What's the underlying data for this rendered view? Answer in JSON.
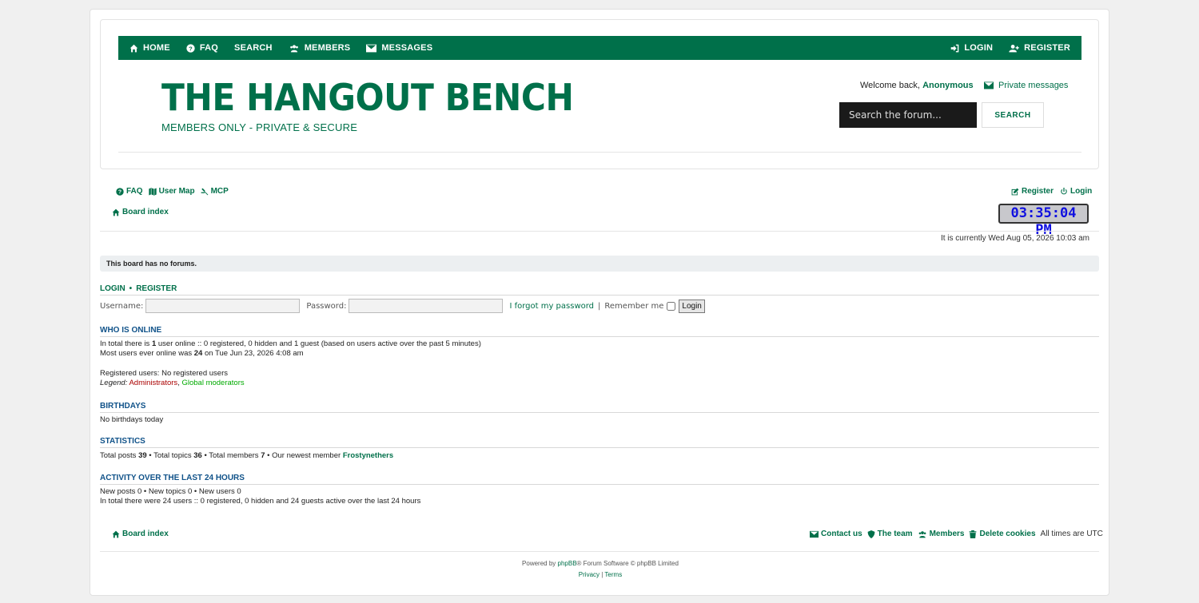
{
  "nav": {
    "left": [
      {
        "label": "HOME",
        "icon": "home-icon"
      },
      {
        "label": "FAQ",
        "icon": "question-icon"
      },
      {
        "label": "SEARCH",
        "icon": ""
      },
      {
        "label": "MEMBERS",
        "icon": "users-icon"
      },
      {
        "label": "MESSAGES",
        "icon": "envelope-icon"
      }
    ],
    "right": [
      {
        "label": "LOGIN",
        "icon": "sign-in-icon"
      },
      {
        "label": "REGISTER",
        "icon": "user-plus-icon"
      }
    ]
  },
  "site": {
    "title": "THE HANGOUT BENCH",
    "subtitle": "MEMBERS ONLY - PRIVATE & SECURE"
  },
  "welcome": {
    "prefix": "Welcome back,",
    "user": "Anonymous",
    "pm_label": "Private messages"
  },
  "search": {
    "placeholder": "Search the forum...",
    "button": "SEARCH"
  },
  "quicklinks": {
    "faq": "FAQ",
    "usermap": "User Map",
    "mcp": "MCP",
    "register": "Register",
    "login": "Login"
  },
  "breadcrumb": "Board index",
  "clock": "03:35:04 PM",
  "current_time": "It is currently Wed Aug 05, 2026 10:03 am",
  "notice": "This board has no forums.",
  "login": {
    "title_login": "LOGIN",
    "sep": "•",
    "title_register": "REGISTER",
    "username_label": "Username:",
    "password_label": "Password:",
    "forgot": "I forgot my password",
    "remember": "Remember me",
    "button": "Login"
  },
  "online": {
    "title": "WHO IS ONLINE",
    "line1_a": "In total there is ",
    "line1_b": "1",
    "line1_c": " user online :: 0 registered, 0 hidden and 1 guest (based on users active over the past 5 minutes)",
    "line2_a": "Most users ever online was ",
    "line2_b": "24",
    "line2_c": " on Tue Jun 23, 2026 4:08 am",
    "registered": "Registered users: No registered users",
    "legend_label": "Legend:",
    "legend_admins": "Administrators",
    "legend_comma": ", ",
    "legend_gmods": "Global moderators"
  },
  "birthdays": {
    "title": "BIRTHDAYS",
    "text": "No birthdays today"
  },
  "statistics": {
    "title": "STATISTICS",
    "text_a": "Total posts ",
    "posts": "39",
    "text_b": " • Total topics ",
    "topics": "36",
    "text_c": " • Total members ",
    "members": "7",
    "text_d": " • Our newest member ",
    "newest": "Frostynethers"
  },
  "activity": {
    "title": "ACTIVITY OVER THE LAST 24 HOURS",
    "line1": "New posts 0 • New topics 0 • New users 0",
    "line2": "In total there were 24 users :: 0 registered, 0 hidden and 24 guests active over the last 24 hours"
  },
  "footer": {
    "board_index": "Board index",
    "contact": "Contact us",
    "team": "The team",
    "members": "Members",
    "delete_cookies": "Delete cookies",
    "timezone": "All times are UTC",
    "powered_a": "Powered by ",
    "powered_link": "phpBB",
    "powered_b": "® Forum Software © phpBB Limited",
    "privacy": "Privacy",
    "bar": " | ",
    "terms": "Terms"
  },
  "colors": {
    "brand": "#00704a",
    "section_title": "#105289",
    "admins": "#aa0000",
    "gmods": "#00aa00",
    "clock_text": "#1010e0"
  }
}
